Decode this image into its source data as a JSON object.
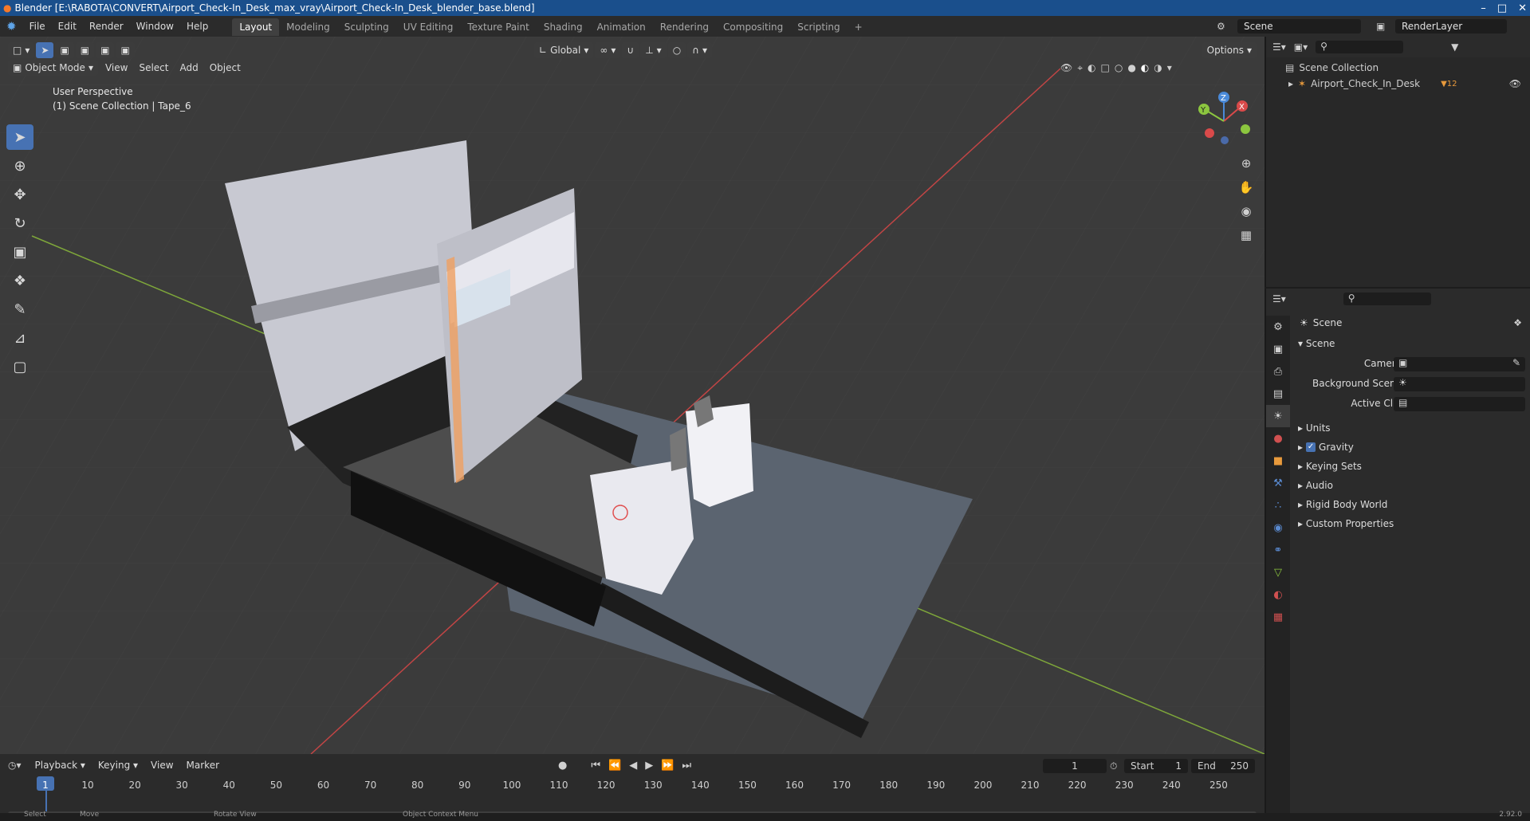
{
  "window": {
    "title": "Blender [E:\\RABOTA\\CONVERT\\Airport_Check-In_Desk_max_vray\\Airport_Check-In_Desk_blender_base.blend]",
    "minimize": "–",
    "maximize": "□",
    "close": "✕"
  },
  "menu": [
    "File",
    "Edit",
    "Render",
    "Window",
    "Help"
  ],
  "workspaces": [
    "Layout",
    "Modeling",
    "Sculpting",
    "UV Editing",
    "Texture Paint",
    "Shading",
    "Animation",
    "Rendering",
    "Compositing",
    "Scripting"
  ],
  "active_workspace": "Layout",
  "add_workspace": "+",
  "scene_name": "Scene",
  "render_layer": "RenderLayer",
  "viewport": {
    "mode": "Object Mode",
    "menus": [
      "View",
      "Select",
      "Add",
      "Object"
    ],
    "transform_orientation": "Global",
    "options_label": "Options",
    "perspective_label": "User Perspective",
    "collection_label": "(1) Scene Collection | Tape_6",
    "gizmo": {
      "x": "X",
      "y": "Y",
      "z": "Z"
    }
  },
  "outliner": {
    "root": "Scene Collection",
    "items": [
      {
        "name": "Airport_Check_In_Desk",
        "badge": "12"
      }
    ]
  },
  "properties": {
    "context": "Scene",
    "panel_title": "Scene",
    "fields": [
      {
        "label": "Camera",
        "value": ""
      },
      {
        "label": "Background Scene",
        "value": ""
      },
      {
        "label": "Active Clip",
        "value": ""
      }
    ],
    "sections": [
      {
        "label": "Units",
        "checkbox": false
      },
      {
        "label": "Gravity",
        "checkbox": true
      },
      {
        "label": "Keying Sets",
        "checkbox": false
      },
      {
        "label": "Audio",
        "checkbox": false
      },
      {
        "label": "Rigid Body World",
        "checkbox": false
      },
      {
        "label": "Custom Properties",
        "checkbox": false
      }
    ]
  },
  "timeline": {
    "menus": [
      "Playback",
      "Keying",
      "View",
      "Marker"
    ],
    "current_frame": "1",
    "start_label": "Start",
    "start": "1",
    "end_label": "End",
    "end": "250",
    "ticks": [
      "1",
      "10",
      "20",
      "30",
      "40",
      "50",
      "60",
      "70",
      "80",
      "90",
      "100",
      "110",
      "120",
      "130",
      "140",
      "150",
      "160",
      "170",
      "180",
      "190",
      "200",
      "210",
      "220",
      "230",
      "240",
      "250"
    ]
  },
  "status_bar": [
    "Select",
    "Move",
    "Rotate View",
    "Object Context Menu"
  ],
  "version": "2.92.0",
  "colors": {
    "accent": "#4772b3",
    "title_bar": "#1a4f8c",
    "x_axis": "#d94a4a",
    "y_axis": "#8cc63f",
    "z_axis": "#4a8ad9"
  }
}
